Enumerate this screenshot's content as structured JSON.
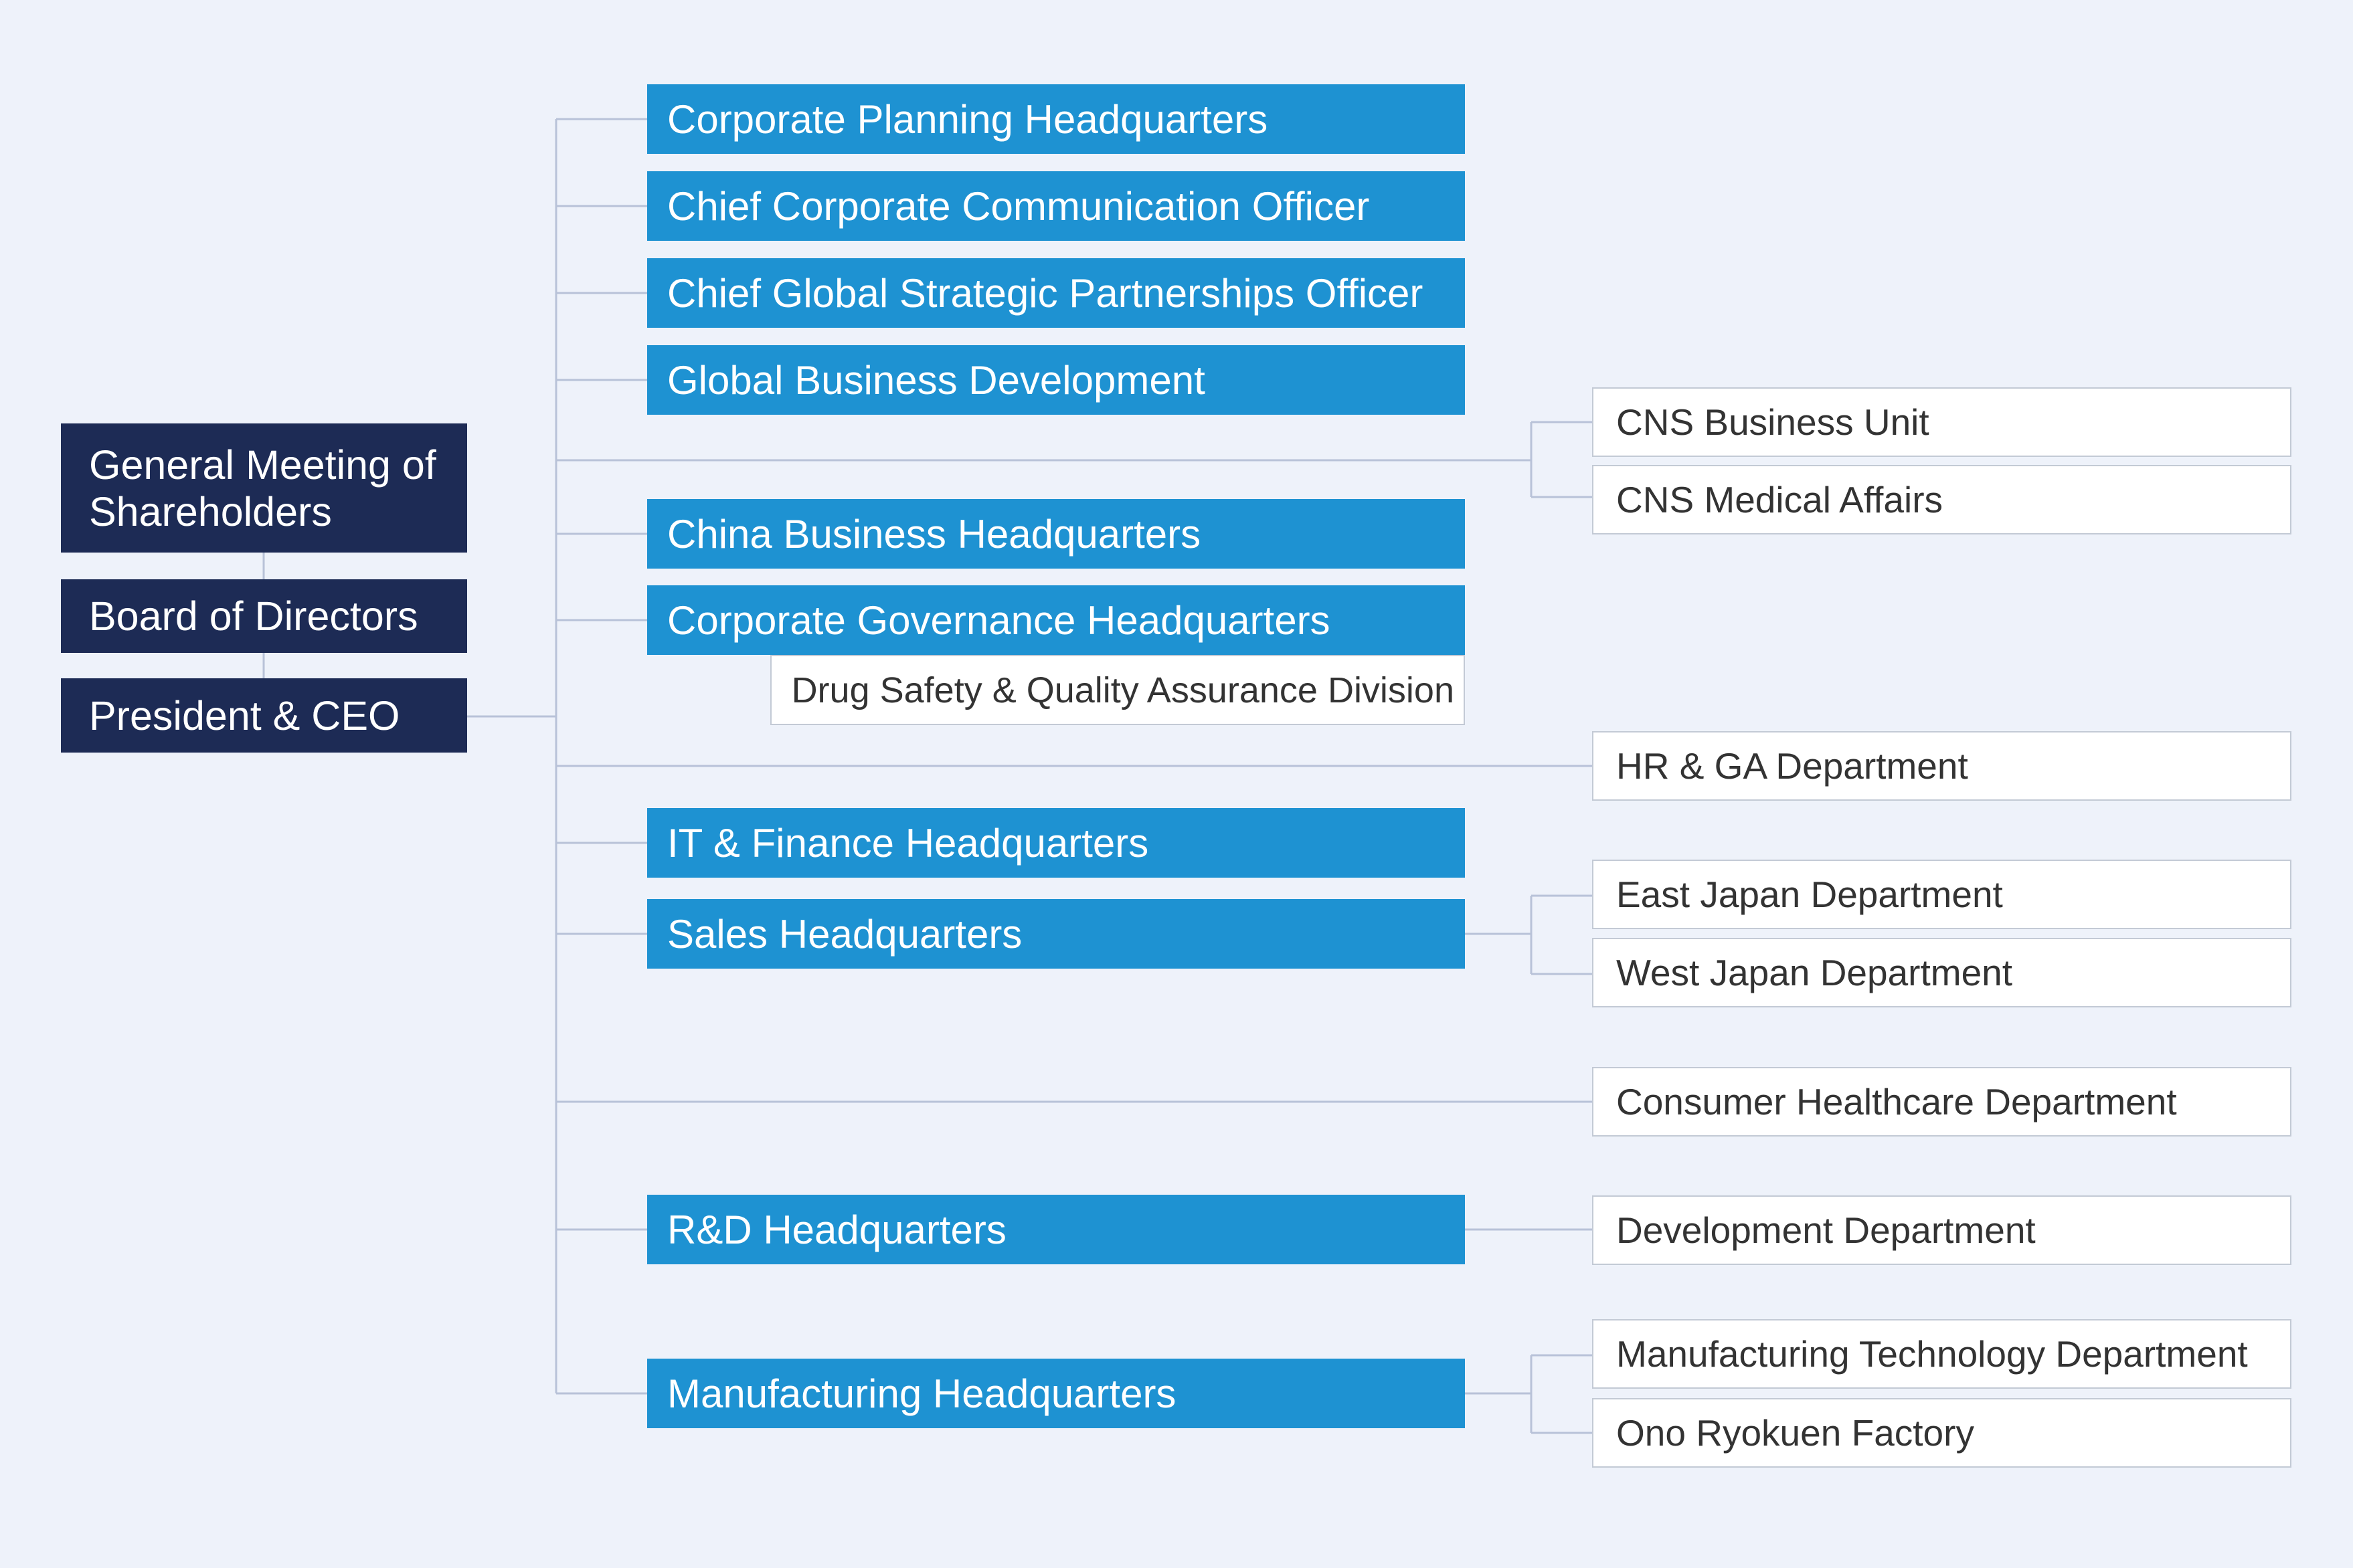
{
  "executive": {
    "shareholders": "General Meeting of Shareholders",
    "board": "Board of Directors",
    "ceo": "President & CEO"
  },
  "headquarters": {
    "corporate_planning": "Corporate Planning Headquarters",
    "communication_officer": "Chief Corporate Communication Officer",
    "partnerships_officer": "Chief Global Strategic Partnerships Officer",
    "global_business_dev": "Global Business Development",
    "china_business": "China Business Headquarters",
    "corporate_governance": "Corporate Governance Headquarters",
    "it_finance": "IT & Finance Headquarters",
    "sales": "Sales Headquarters",
    "rd": "R&D Headquarters",
    "manufacturing": "Manufacturing Headquarters"
  },
  "divisions": {
    "drug_safety": "Drug Safety & Quality Assurance Division"
  },
  "departments": {
    "cns_business_unit": "CNS Business Unit",
    "cns_medical_affairs": "CNS Medical Affairs",
    "hr_ga": "HR & GA Department",
    "east_japan": "East Japan Department",
    "west_japan": "West Japan Department",
    "consumer_healthcare": "Consumer Healthcare Department",
    "development": "Development Department",
    "manufacturing_technology": "Manufacturing Technology Department",
    "ono_ryokuen": "Ono Ryokuen Factory"
  },
  "colors": {
    "background": "#eef2fa",
    "executive_box": "#1d2b55",
    "headquarters_box": "#1e92d2",
    "department_box": "#ffffff",
    "connector_line": "#b8c2d8"
  }
}
